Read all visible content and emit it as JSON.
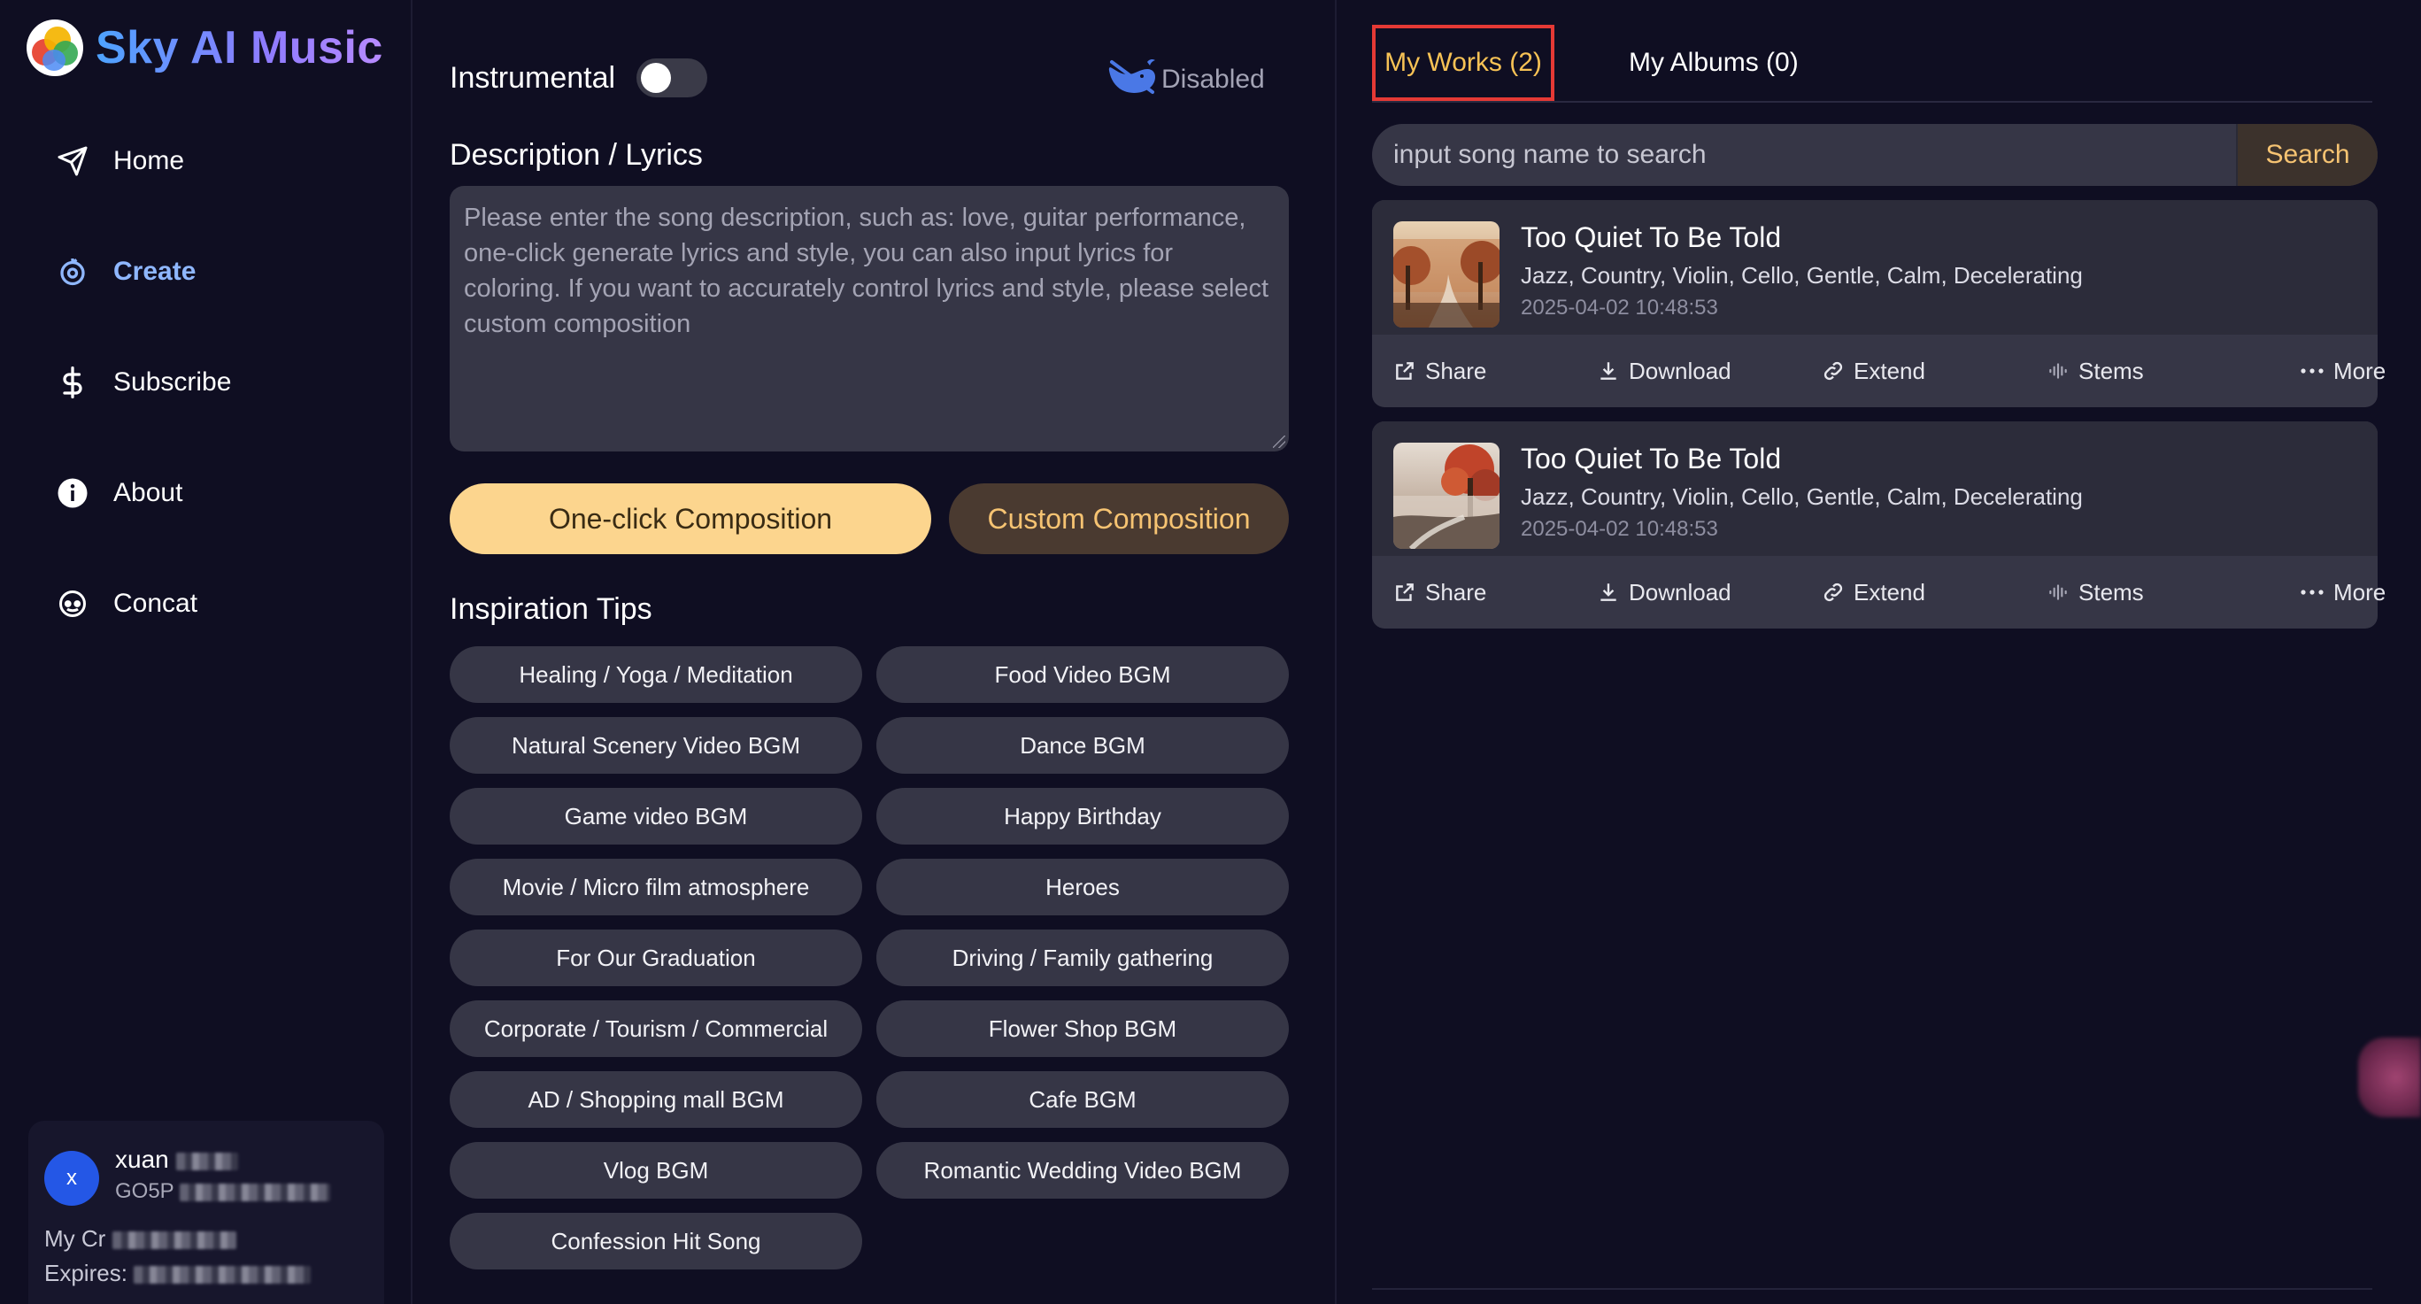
{
  "brand": {
    "name": "Sky AI Music"
  },
  "nav": [
    {
      "label": "Home",
      "icon": "send-icon",
      "active": false
    },
    {
      "label": "Create",
      "icon": "create-icon",
      "active": true
    },
    {
      "label": "Subscribe",
      "icon": "dollar-icon",
      "active": false
    },
    {
      "label": "About",
      "icon": "info-icon",
      "active": false
    },
    {
      "label": "Concat",
      "icon": "contact-icon",
      "active": false
    }
  ],
  "user": {
    "initial": "x",
    "name": "xuan",
    "id_prefix": "GO5P",
    "credits_label": "My Cr",
    "expires_label": "Expires:"
  },
  "create": {
    "instrumental_label": "Instrumental",
    "instrumental_on": false,
    "disabled_label": "Disabled",
    "description_title": "Description / Lyrics",
    "description_placeholder": "Please enter the song description, such as: love, guitar performance, one-click generate lyrics and style, you can also input lyrics for coloring. If you want to accurately control lyrics and style, please select custom composition",
    "oneclick_label": "One-click Composition",
    "custom_label": "Custom Composition",
    "tips_title": "Inspiration Tips",
    "tips": [
      "Healing / Yoga / Meditation",
      "Food Video BGM",
      "Natural Scenery Video BGM",
      "Dance BGM",
      "Game video BGM",
      "Happy Birthday",
      "Movie / Micro film atmosphere",
      "Heroes",
      "For Our Graduation",
      "Driving / Family gathering",
      "Corporate / Tourism / Commercial",
      "Flower Shop BGM",
      "AD / Shopping mall BGM",
      "Cafe BGM",
      "Vlog BGM",
      "Romantic Wedding Video BGM",
      "Confession Hit Song"
    ]
  },
  "works": {
    "tab_works": "My Works (2)",
    "tab_albums": "My Albums (0)",
    "search_placeholder": "input song name to search",
    "search_button": "Search",
    "songs": [
      {
        "title": "Too Quiet To Be Told",
        "tags": "Jazz, Country, Violin, Cello, Gentle, Calm, Decelerating",
        "date": "2025-04-02 10:48:53"
      },
      {
        "title": "Too Quiet To Be Told",
        "tags": "Jazz, Country, Violin, Cello, Gentle, Calm, Decelerating",
        "date": "2025-04-02 10:48:53"
      }
    ],
    "actions": {
      "share": "Share",
      "download": "Download",
      "extend": "Extend",
      "stems": "Stems",
      "more": "More"
    }
  },
  "colors": {
    "background": "#0f0e22",
    "accent_gold": "#fcd58e",
    "active_nav": "#8fb7ff",
    "highlight_box": "#e53935"
  }
}
